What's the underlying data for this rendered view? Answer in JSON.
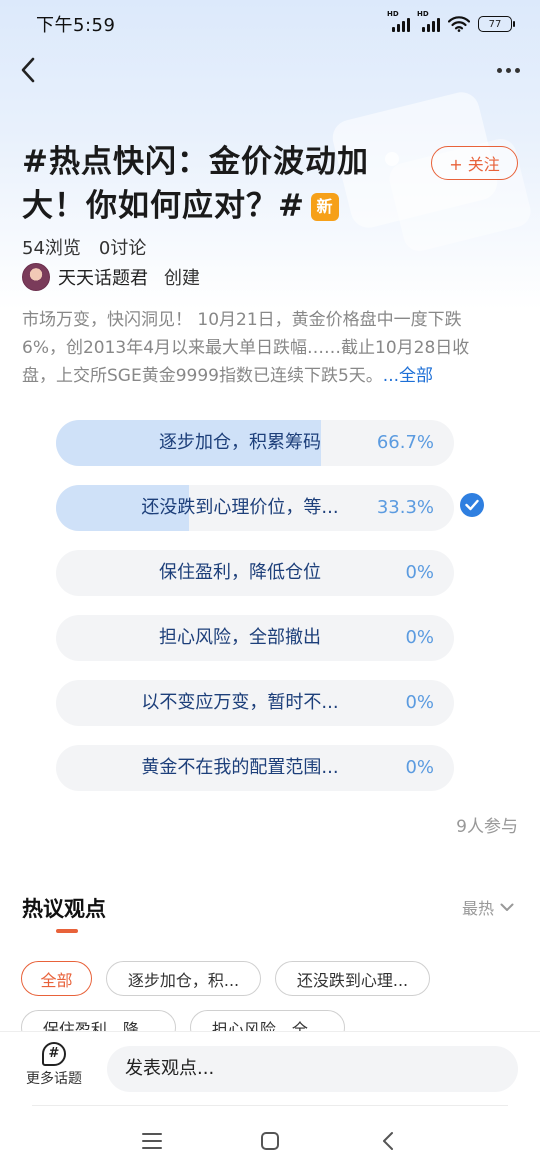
{
  "status_bar": {
    "time": "下午5:59",
    "battery": "77",
    "signal_badges": [
      "HD",
      "HD"
    ],
    "icons": [
      "signal-icon",
      "signal-icon",
      "wifi-icon",
      "battery-icon"
    ]
  },
  "nav": {
    "back_icon": "chevron-left-icon",
    "more_icon": "more-dots-icon"
  },
  "topic": {
    "title": "#热点快闪：金价波动加大！你如何应对？#",
    "new_badge": "新",
    "follow_label": "+ 关注",
    "views": "54浏览",
    "discussions": "0讨论",
    "creator_name": "天天话题君",
    "creator_action": "创建",
    "description": "市场万变，快闪洞见！ 10月21日，黄金价格盘中一度下跌6%，创2013年4月以来最大单日跌幅……截止10月28日收盘，上交所SGE黄金9999指数已连续下跌5天。",
    "description_more": "...全部"
  },
  "poll": {
    "options": [
      {
        "label": "逐步加仓，积累筹码",
        "percent": "66.7%",
        "share": 0.667,
        "selected": false
      },
      {
        "label": "还没跌到心理价位，等...",
        "percent": "33.3%",
        "share": 0.333,
        "selected": true
      },
      {
        "label": "保住盈利，降低仓位",
        "percent": "0%",
        "share": 0,
        "selected": false
      },
      {
        "label": "担心风险，全部撤出",
        "percent": "0%",
        "share": 0,
        "selected": false
      },
      {
        "label": "以不变应万变，暂时不...",
        "percent": "0%",
        "share": 0,
        "selected": false
      },
      {
        "label": "黄金不在我的配置范围...",
        "percent": "0%",
        "share": 0,
        "selected": false
      }
    ],
    "participants": "9人参与"
  },
  "hot": {
    "title": "热议观点",
    "sort_label": "最热",
    "chips": [
      {
        "label": "全部",
        "active": true
      },
      {
        "label": "逐步加仓，积...",
        "active": false
      },
      {
        "label": "还没跌到心理...",
        "active": false
      },
      {
        "label": "保住盈利，降...",
        "active": false
      },
      {
        "label": "担心风险，全...",
        "active": false
      }
    ]
  },
  "bottom": {
    "more_topics_label": "更多话题",
    "comment_placeholder": "发表观点..."
  },
  "colors": {
    "accent": "#e8623a",
    "poll_fill": "#cfe1f8",
    "poll_text": "#1d3f7a",
    "poll_percent": "#5b9be0",
    "selected_check": "#2f7fe0",
    "new_badge": "#f6a019",
    "link": "#1d6fd6"
  }
}
